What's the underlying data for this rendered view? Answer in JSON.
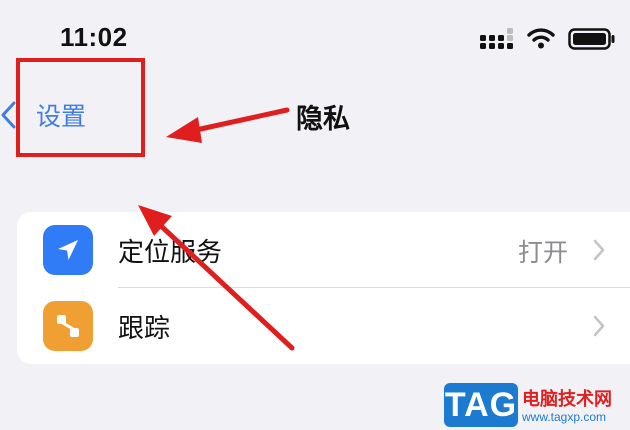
{
  "status_bar": {
    "time": "11:02",
    "icons": [
      "cellular-signal-icon",
      "wifi-icon",
      "battery-icon"
    ]
  },
  "nav": {
    "back_label": "设置",
    "title": "隐私"
  },
  "settings_rows": [
    {
      "icon": "location-arrow-icon",
      "icon_color": "#2f7cf6",
      "label": "定位服务",
      "value": "打开"
    },
    {
      "icon": "tracking-icon",
      "icon_color": "#f0a033",
      "label": "跟踪",
      "value": ""
    }
  ],
  "colors": {
    "accent": "#3f7ee0",
    "annotation_red": "#e01e1e",
    "background": "#f2f2f6"
  },
  "watermark": {
    "logo": "TAG",
    "site_name": "电脑技术网",
    "url": "www.tagxp.com"
  }
}
